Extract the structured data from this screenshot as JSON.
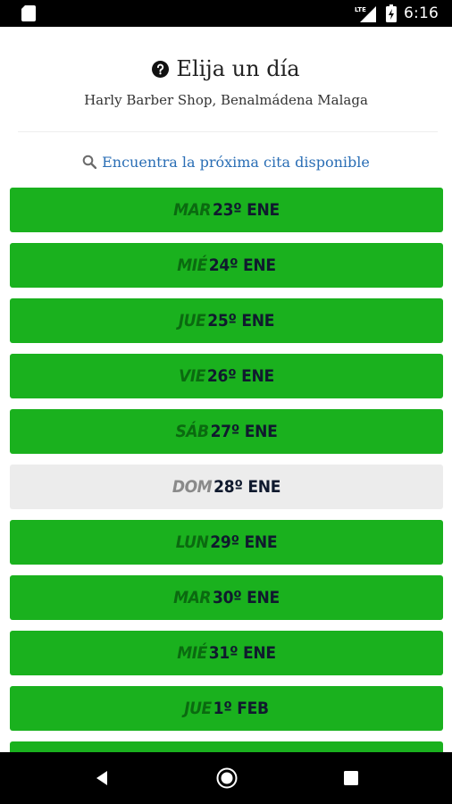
{
  "status_bar": {
    "time": "6:16",
    "icons": [
      "sd-card-icon",
      "lte-signal-icon",
      "battery-charging-icon"
    ]
  },
  "header": {
    "title": "Elija un día",
    "title_icon": "question-circle-icon",
    "subtitle": "Harly Barber Shop, Benalmádena Malaga"
  },
  "search": {
    "icon": "search-icon",
    "label": "Encuentra la próxima cita disponible"
  },
  "days": [
    {
      "dow": "MAR",
      "date": "23º ENE",
      "available": true
    },
    {
      "dow": "MIÉ",
      "date": "24º ENE",
      "available": true
    },
    {
      "dow": "JUE",
      "date": "25º ENE",
      "available": true
    },
    {
      "dow": "VIE",
      "date": "26º ENE",
      "available": true
    },
    {
      "dow": "SÁB",
      "date": "27º ENE",
      "available": true
    },
    {
      "dow": "DOM",
      "date": "28º ENE",
      "available": false
    },
    {
      "dow": "LUN",
      "date": "29º ENE",
      "available": true
    },
    {
      "dow": "MAR",
      "date": "30º ENE",
      "available": true
    },
    {
      "dow": "MIÉ",
      "date": "31º ENE",
      "available": true
    },
    {
      "dow": "JUE",
      "date": "1º FEB",
      "available": true
    },
    {
      "dow": "",
      "date": "",
      "available": true
    }
  ],
  "colors": {
    "available_bg": "#1ab11e",
    "closed_bg": "#ececec",
    "link": "#2a6eb5"
  },
  "nav_bar": {
    "icons": [
      "back-icon",
      "home-icon",
      "recent-apps-icon"
    ]
  }
}
